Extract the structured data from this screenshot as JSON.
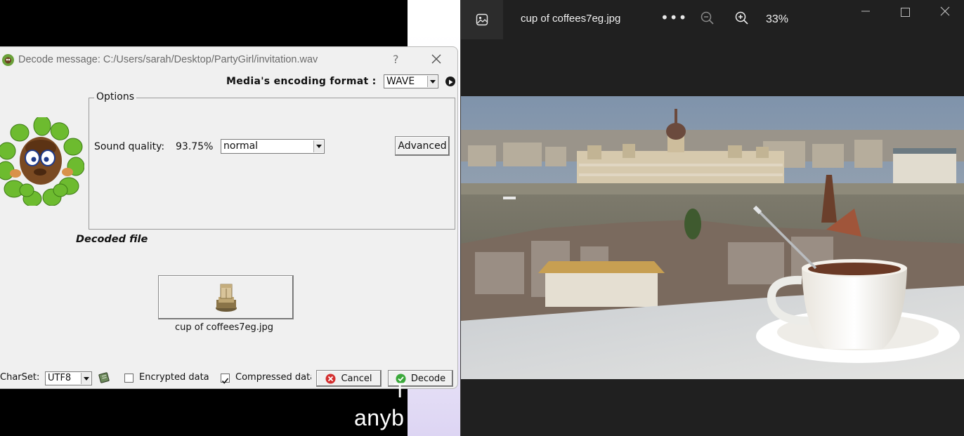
{
  "background": {
    "partial_text_top": "T",
    "partial_text_bottom": "anyb"
  },
  "viewer": {
    "title": "cup of coffees7eg.jpg",
    "more_label": "•••",
    "zoom": "33%"
  },
  "dialog": {
    "title": "Decode message: C:/Users/sarah/Desktop/PartyGirl/invitation.wav",
    "help_label": "?",
    "format_label": "Media's encoding format :",
    "format_value": "WAVE",
    "options_legend": "Options",
    "sound_quality_label": "Sound quality:",
    "sound_quality_value": "93.75%",
    "sound_quality_option": "normal",
    "advanced_label": "Advanced",
    "decoded_file_label": "Decoded file",
    "file_name": "cup of coffees7eg.jpg",
    "charset_label": "CharSet:",
    "charset_value": "UTF8",
    "encrypted_label": "Encrypted data",
    "encrypted_checked": false,
    "compressed_label": "Compressed data",
    "compressed_checked": true,
    "cancel_label": "Cancel",
    "decode_label": "Decode"
  },
  "colors": {
    "viewer_bg": "#202020",
    "dialog_bg": "#f0f0f0",
    "cancel_icon": "#d32f2f",
    "decode_icon": "#3aa83a"
  }
}
